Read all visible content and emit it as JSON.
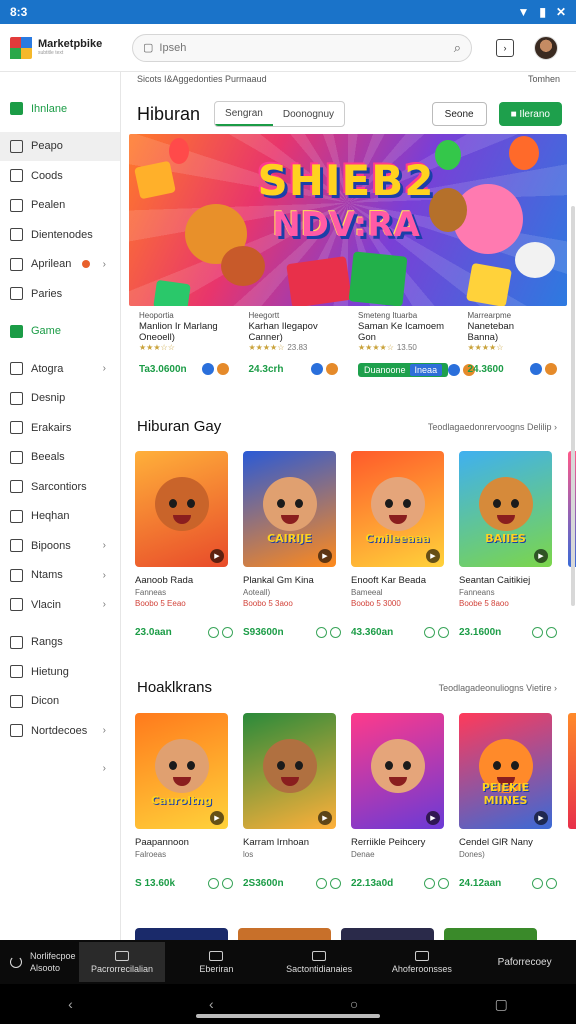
{
  "status_bar": {
    "time": "8:3",
    "battery": "▮"
  },
  "app": {
    "name": "Marketpbike",
    "tagline": "subtitle text"
  },
  "search": {
    "placeholder": "Ipseh"
  },
  "sidebar": {
    "items": [
      {
        "label": "Ihnlane",
        "icon": "home-icon",
        "green": true
      },
      {
        "label": "Peapo",
        "icon": "file-icon",
        "selected": true
      },
      {
        "label": "Coods",
        "icon": "folder-icon"
      },
      {
        "label": "Pealen",
        "icon": "bookmark-icon"
      },
      {
        "label": "Dientenodes",
        "icon": "house-icon"
      },
      {
        "label": "Aprilean",
        "icon": "clock-icon",
        "badge": true,
        "chevron": "›"
      },
      {
        "label": "Paries",
        "icon": "edit-icon"
      },
      {
        "label": "Game",
        "icon": "home-icon",
        "green": true
      },
      {
        "label": "Atogra",
        "icon": "grid-icon",
        "chevron": "›"
      },
      {
        "label": "Desnip",
        "icon": "calendar-icon"
      },
      {
        "label": "Erakairs",
        "icon": "shield-icon"
      },
      {
        "label": "Beeals",
        "icon": "square-icon"
      },
      {
        "label": "Sarcontiors",
        "icon": "link-icon"
      },
      {
        "label": "Heqhan",
        "icon": "bag-icon"
      },
      {
        "label": "Bipoons",
        "icon": "gear-icon",
        "chevron": "›"
      },
      {
        "label": "Ntams",
        "icon": "clock-icon",
        "chevron": "›"
      },
      {
        "label": "Vlacin",
        "icon": "send-icon",
        "chevron": "›"
      },
      {
        "label": "Rangs",
        "icon": "bag-icon"
      },
      {
        "label": "Hietung",
        "icon": "list-icon"
      },
      {
        "label": "Dicon",
        "icon": "doc-icon"
      },
      {
        "label": "Nortdecoes",
        "icon": "grid-icon",
        "chevron": "›"
      },
      {
        "label": "",
        "icon": "",
        "chevron": "›"
      }
    ]
  },
  "main": {
    "crumbs": {
      "left": "Sicots I&Aggedonties   Purmaaud",
      "right": "Tomhen"
    },
    "title": "Hiburan",
    "tabs": [
      "Sengran",
      "Doonognuy"
    ],
    "btn_secondary": "Seone",
    "btn_primary": "■ Ilerano",
    "hero": {
      "line1": "SHIEB2",
      "line2": "NDV:RA"
    },
    "featured": [
      {
        "title": "Manlion Ir Marlang",
        "sub1": "Oneoell)",
        "small": "Heoportia",
        "stars": "★★★☆☆",
        "price": "Ta3.0600n",
        "icons": [
          "#2a6fdb",
          "#e58a2a"
        ]
      },
      {
        "title": "Karhan Ilegapov",
        "sub1": "Canner)",
        "small": "Heegortt",
        "stars": "★★★★☆",
        "rating": "23.83",
        "price": "24.3crh",
        "icons": [
          "#2a6fdb",
          "#e58a2a"
        ]
      },
      {
        "title": "Saman Ke Icamoem",
        "sub1": "Gon",
        "small": "Smeteng Ituarba",
        "stars": "★★★★☆",
        "rating": "13.50",
        "install": "Duanoone",
        "install2": "Ineaa",
        "price": ""
      },
      {
        "title": "Naneteban",
        "sub1": "Banna)",
        "small": "Marrearpme",
        "stars": "★★★★☆",
        "price": "24.3600",
        "icons": [
          "#2a6fdb",
          "#e58a2a"
        ]
      }
    ],
    "section1": {
      "title": "Hiburan Gay",
      "more": "Teodlagaedonrervoogns Delilip ›",
      "tiles": [
        {
          "name": "Aanoob Rada",
          "meta1": "Fanneas",
          "meta2": "Boobo 5 Eeao",
          "price": "23.0aan",
          "c1": "#ffb03a",
          "c2": "#e84b2a",
          "face": "#c9642a",
          "label": ""
        },
        {
          "name": "Plankal Gm Kina",
          "meta1": "Aoteall)",
          "meta2": "Boobo 5 3aoo",
          "price": "S93600n",
          "c1": "#2a5ad6",
          "c2": "#ff8a1c",
          "face": "#e0a070",
          "label": "CAIRIJE"
        },
        {
          "name": "Enooft Kar Beada",
          "meta1": "Bameeal",
          "meta2": "Boobo 5 3000",
          "price": "43.360an",
          "c1": "#ff5a2a",
          "c2": "#ffd23a",
          "face": "#e5a57a",
          "label": "Cmileeaaa"
        },
        {
          "name": "Seantan Caitikiej",
          "meta1": "Fanneans",
          "meta2": "Boobe 5 8aoo",
          "price": "23.1600n",
          "c1": "#3fb0f0",
          "c2": "#7cd64a",
          "face": "#d68a3a",
          "label": "BAIIES"
        }
      ]
    },
    "section2": {
      "title": "Hoaklkrans",
      "more": "Teodlagadeonuliogns Vietire ›",
      "tiles": [
        {
          "name": "Paapannoon",
          "meta1": "Falroeas",
          "meta2": "",
          "price": "S 13.60k",
          "c1": "#ff7a1c",
          "c2": "#ffd23a",
          "face": "#e0a070",
          "label": "Cauroltng"
        },
        {
          "name": "Karram Irnhoan",
          "meta1": "los",
          "meta2": "",
          "price": "2S3600n",
          "c1": "#2a8a3a",
          "c2": "#ffb03a",
          "face": "#b07040",
          "label": ""
        },
        {
          "name": "Rerriikle Peihcery",
          "meta1": "Denae",
          "meta2": "",
          "price": "22.13a0d",
          "c1": "#ff3a8a",
          "c2": "#6a3ad6",
          "face": "#e5a57a",
          "label": ""
        },
        {
          "name": "Cendel GlR Nany",
          "meta1": "Dones)",
          "meta2": "",
          "price": "24.12aan",
          "c1": "#ff3a5a",
          "c2": "#3a6ad6",
          "face": "#ff8a2a",
          "label": "PEIEKIE MIINES"
        }
      ]
    }
  },
  "bottom_bar": {
    "refresh_title": "Norlifecpoe",
    "refresh_sub": "Alsooto",
    "items": [
      "Pacrorrecilalian",
      "Eberiran",
      "Sactontidianaies",
      "Ahoferoonsses",
      "Paforrecoey"
    ]
  }
}
